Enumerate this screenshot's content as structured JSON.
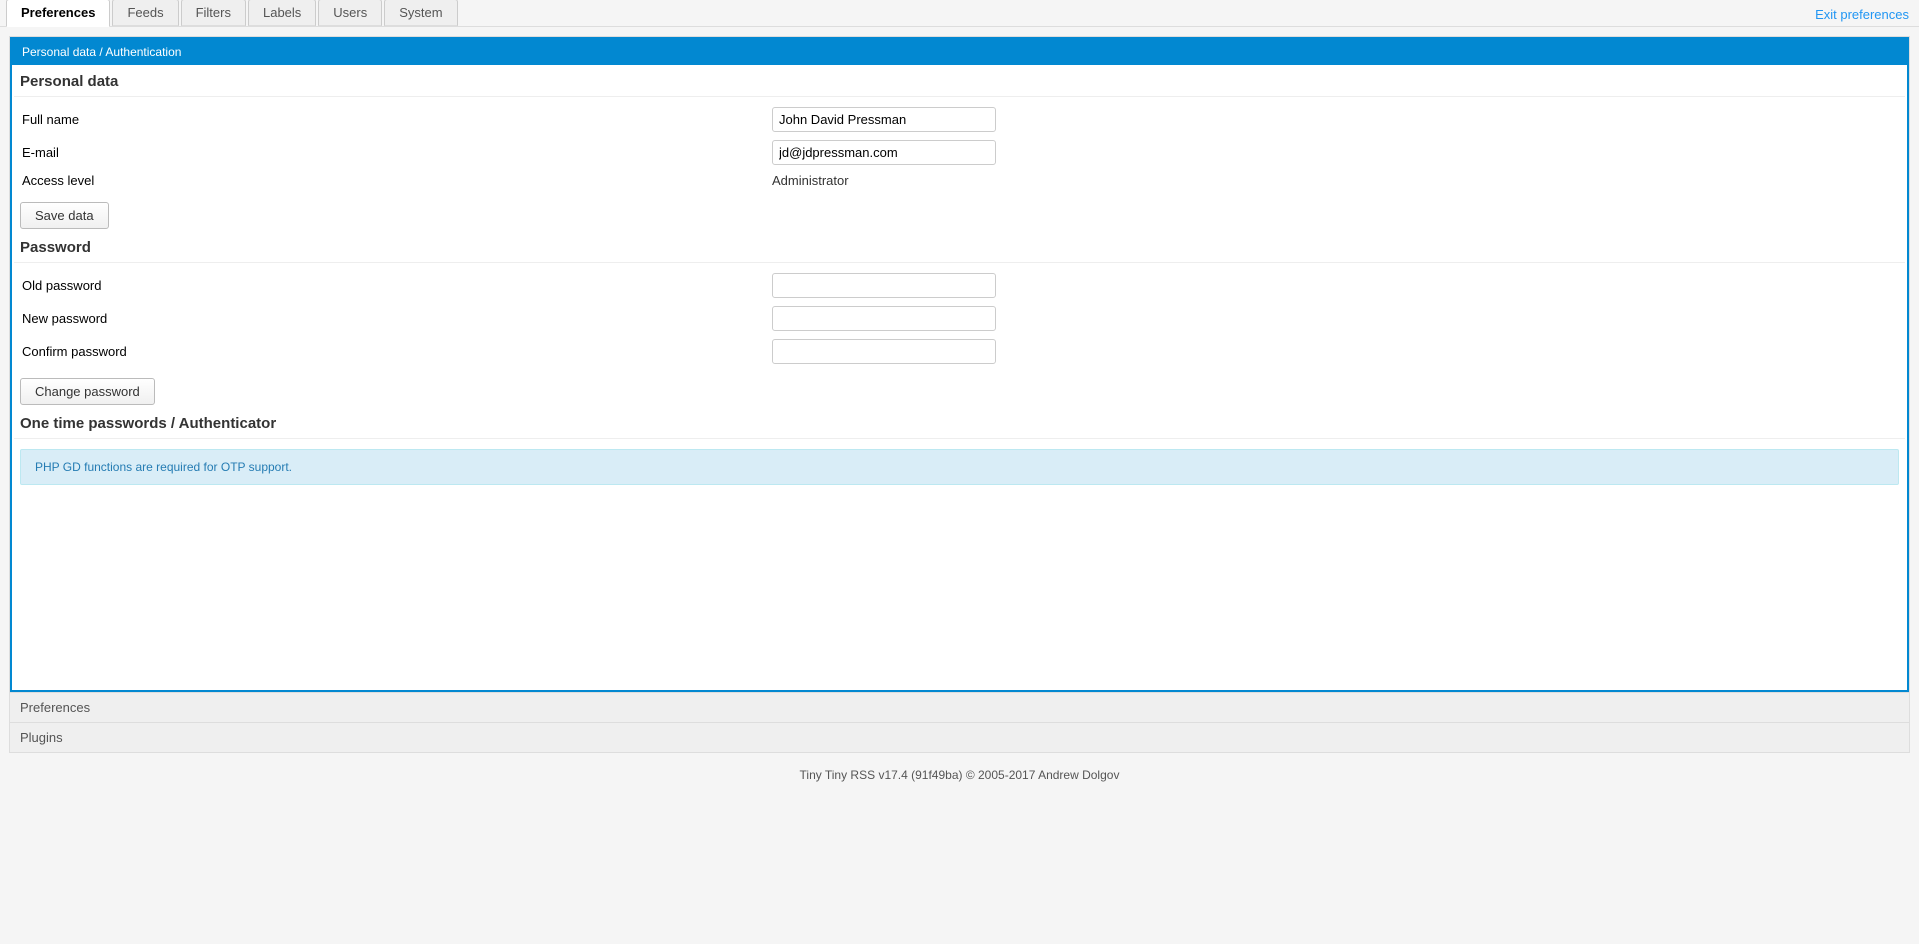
{
  "tabs": {
    "preferences": "Preferences",
    "feeds": "Feeds",
    "filters": "Filters",
    "labels": "Labels",
    "users": "Users",
    "system": "System"
  },
  "exit_link": "Exit preferences",
  "accordion": {
    "open_title": "Personal data / Authentication",
    "closed1": "Preferences",
    "closed2": "Plugins"
  },
  "sections": {
    "personal_data": "Personal data",
    "password": "Password",
    "otp": "One time passwords / Authenticator"
  },
  "form": {
    "full_name_label": "Full name",
    "full_name_value": "John David Pressman",
    "email_label": "E-mail",
    "email_value": "jd@jdpressman.com",
    "access_level_label": "Access level",
    "access_level_value": "Administrator",
    "save_button": "Save data",
    "old_password_label": "Old password",
    "new_password_label": "New password",
    "confirm_password_label": "Confirm password",
    "change_password_button": "Change password"
  },
  "notice": "PHP GD functions are required for OTP support.",
  "footer": "Tiny Tiny RSS v17.4 (91f49ba) © 2005-2017 Andrew Dolgov"
}
